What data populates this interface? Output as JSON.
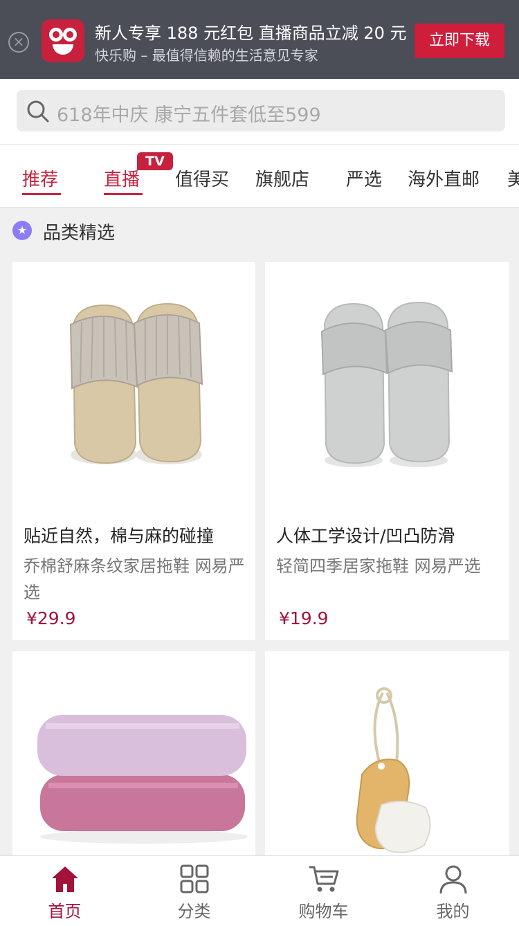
{
  "banner": {
    "close_icon": "close-icon",
    "logo_icon": "kaolegou-logo",
    "title": "新人专享 188 元红包 直播商品立减 20 元",
    "subtitle": "快乐购 – 最值得信赖的生活意见专家",
    "download_label": "立即下载",
    "accent_color": "#cf1d3c"
  },
  "search": {
    "icon": "search-icon",
    "placeholder": "618年中庆 康宁五件套低至599"
  },
  "tabs": [
    {
      "label": "推荐",
      "active": true
    },
    {
      "label": "直播",
      "active": true,
      "badge": "TV"
    },
    {
      "label": "值得买",
      "active": false
    },
    {
      "label": "旗舰店",
      "active": false
    },
    {
      "label": "严选",
      "active": false
    },
    {
      "label": "海外直邮",
      "active": false
    },
    {
      "label": "美",
      "active": false
    }
  ],
  "section": {
    "icon": "star-icon",
    "title": "品类精选"
  },
  "products": [
    {
      "tagline": "贴近自然，棉与麻的碰撞",
      "name": "乔棉舒麻条纹家居拖鞋 网易严选",
      "price": "¥29.9",
      "image": "linen-slippers"
    },
    {
      "tagline": "人体工学设计/凹凸防滑",
      "name": "轻简四季居家拖鞋 网易严选",
      "price": "¥19.9",
      "image": "grey-slides"
    },
    {
      "tagline": "",
      "name": "",
      "price": "",
      "image": "folded-towels"
    },
    {
      "tagline": "",
      "name": "",
      "price": "",
      "image": "wooden-face-brush"
    }
  ],
  "bottom_nav": [
    {
      "label": "首页",
      "icon": "home-icon",
      "active": true
    },
    {
      "label": "分类",
      "icon": "grid-icon",
      "active": false
    },
    {
      "label": "购物车",
      "icon": "cart-icon",
      "active": false
    },
    {
      "label": "我的",
      "icon": "user-icon",
      "active": false
    }
  ],
  "colors": {
    "brand": "#c8213e",
    "price": "#a3123a",
    "banner_bg": "#4b4d57"
  }
}
